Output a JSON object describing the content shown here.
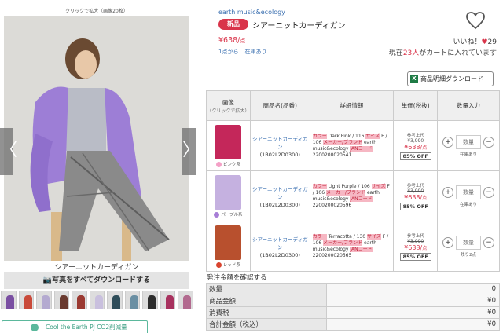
{
  "gallery": {
    "zoom_hint": "クリックで拡大（画像20枚）",
    "caption": "シアーニットカーディガン",
    "download_photos": "📷写真をすべてダウンロードする",
    "prev": "〈",
    "next": "〉",
    "thumb_colors": [
      "#7a4fa2",
      "#c94a3a",
      "#b4aad0",
      "#6a3a2f",
      "#9b3a32",
      "#c9c0de",
      "#2f4d5a",
      "#6a8fa3",
      "#2d2d2d",
      "#a8325f",
      "#b26a8f"
    ]
  },
  "cool_banner": "Cool the Earth PJ CO2削減量",
  "product": {
    "brand": "earth music&ecology",
    "badge": "新品",
    "name": "シアーニットカーディガン",
    "price": "¥638/",
    "price_unit": "点",
    "lot_min": "1点から",
    "in_stock": "在庫あり",
    "likes_label": "いいね！",
    "likes_heart": "♥",
    "likes_count": "29",
    "cart_prefix": "現在",
    "cart_count": "23人",
    "cart_suffix": "がカートに入れています",
    "spec_download": "商品明細ダウンロード",
    "excel_icon": "X"
  },
  "table": {
    "headers": {
      "image": "画像",
      "image_sub": "（クリックで拡大）",
      "name": "商品名(品番)",
      "detail": "詳細情報",
      "price": "単価(税抜)",
      "qty": "数量入力"
    },
    "rows": [
      {
        "swatch": "#c4275a",
        "dot": "#f4a0c6",
        "color_name": "ピンク系",
        "name": "シアーニットカーディガン",
        "code": "(1B02L2D0300)",
        "color_label": "カラー",
        "color_value": "Dark Pink / 116",
        "size_label": "サイズ",
        "size_value": "F / 106",
        "maker_label": "メーカー/ブランド",
        "maker_value": "earth music&ecology",
        "jan_label": "JANコード",
        "jan_value": "2200200020541",
        "ref_label": "参考上代",
        "ref_price": "¥3,990",
        "now_price": "¥638/",
        "now_unit": "点",
        "off": "85% OFF",
        "qty_placeholder": "数量",
        "stock": "在庫あり"
      },
      {
        "swatch": "#c5b1e0",
        "dot": "#a77ed6",
        "color_name": "パープル系",
        "name": "シアーニットカーディガン",
        "code": "(1B02L2D0300)",
        "color_label": "カラー",
        "color_value": "Light Purple / 106",
        "size_label": "サイズ",
        "size_value": "F / 106",
        "maker_label": "メーカー/ブランド",
        "maker_value": "earth music&ecology",
        "jan_label": "JANコード",
        "jan_value": "2200200020596",
        "ref_label": "参考上代",
        "ref_price": "¥3,990",
        "now_price": "¥638/",
        "now_unit": "点",
        "off": "85% OFF",
        "qty_placeholder": "数量",
        "stock": "在庫あり"
      },
      {
        "swatch": "#b8502e",
        "dot": "#d9442f",
        "color_name": "レッド系",
        "name": "シアーニットカーディガン",
        "code": "(1B02L2D0300)",
        "color_label": "カラー",
        "color_value": "Terracotta / 130",
        "size_label": "サイズ",
        "size_value": "F / 106",
        "maker_label": "メーカー/ブランド",
        "maker_value": "earth music&ecology",
        "jan_label": "JANコード",
        "jan_value": "2200200020565",
        "ref_label": "参考上代",
        "ref_price": "¥3,990",
        "now_price": "¥638/",
        "now_unit": "点",
        "off": "85% OFF",
        "qty_placeholder": "数量",
        "stock": "残り2点"
      }
    ]
  },
  "totals": {
    "confirm": "発注金額を確認する",
    "rows": [
      {
        "label": "数量",
        "value": "0"
      },
      {
        "label": "商品金額",
        "value": "¥0"
      },
      {
        "label": "消費税",
        "value": "¥0"
      },
      {
        "label": "合計金額（税込）",
        "value": "¥0"
      }
    ]
  },
  "colors": {
    "accent": "#d9344a",
    "link": "#3a6fb0"
  }
}
